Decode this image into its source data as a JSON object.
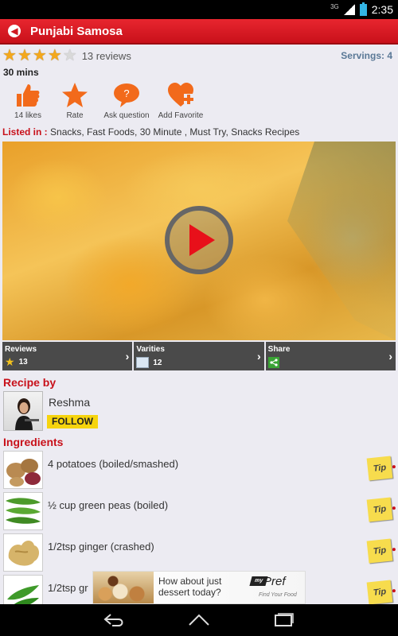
{
  "status": {
    "network": "3G",
    "time": "2:35"
  },
  "app": {
    "title": "Punjabi Samosa"
  },
  "rating": {
    "stars": 4,
    "max": 5,
    "reviews_label": "13 reviews"
  },
  "servings_label": "Servings: 4",
  "cook_time": "30 mins",
  "actions": [
    {
      "label": "14 likes",
      "icon": "thumbs-up-icon"
    },
    {
      "label": "Rate",
      "icon": "star-icon"
    },
    {
      "label": "Ask question",
      "icon": "question-bubble-icon"
    },
    {
      "label": "Add Favorite",
      "icon": "heart-plus-icon"
    }
  ],
  "listed": {
    "prefix": "Listed in :",
    "categories": "Snacks, Fast Foods, 30 Minute , Must Try, Snacks Recipes"
  },
  "info_bar": [
    {
      "title": "Reviews",
      "value": "13",
      "icon": "star-icon"
    },
    {
      "title": "Varities",
      "value": "12",
      "icon": "document-icon"
    },
    {
      "title": "Share",
      "value": "",
      "icon": "share-icon"
    }
  ],
  "recipe_by": {
    "heading": "Recipe by",
    "name": "Reshma",
    "follow_label": "FOLLOW"
  },
  "ingredients": {
    "heading": "Ingredients",
    "items": [
      {
        "text": "4 potatoes (boiled/smashed)",
        "tip": "Tip"
      },
      {
        "text": "½ cup green peas (boiled)",
        "tip": "Tip"
      },
      {
        "text": "1/2tsp ginger (crashed)",
        "tip": "Tip"
      },
      {
        "text": "1/2tsp gr",
        "tip": "Tip"
      }
    ]
  },
  "ad": {
    "headline": "How about just dessert today?",
    "brand": "Pref",
    "brand_prefix": "my",
    "tagline": "Find Your Food"
  }
}
